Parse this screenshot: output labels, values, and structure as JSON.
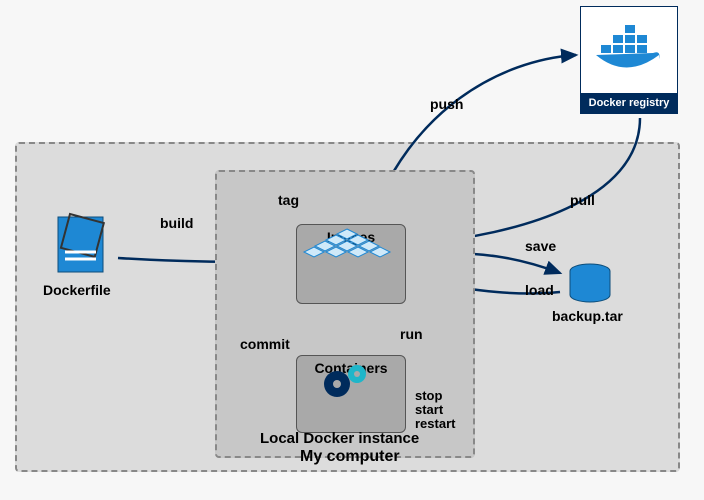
{
  "outer_label": "My computer",
  "inner_label": "Local Docker instance",
  "dockerfile": "Dockerfile",
  "backup": "backup.tar",
  "registry": {
    "title": "Docker registry"
  },
  "nodes": {
    "images": "Images",
    "containers": "Containers"
  },
  "cmds": {
    "build": "build",
    "tag": "tag",
    "push": "push",
    "pull": "pull",
    "save": "save",
    "load": "load",
    "run": "run",
    "commit": "commit",
    "stop": "stop",
    "start": "start",
    "restart": "restart"
  },
  "chart_data": {
    "type": "flow-diagram",
    "nodes": [
      {
        "id": "dockerfile",
        "label": "Dockerfile"
      },
      {
        "id": "images",
        "label": "Images",
        "group": "Local Docker instance"
      },
      {
        "id": "containers",
        "label": "Containers",
        "group": "Local Docker instance"
      },
      {
        "id": "registry",
        "label": "Docker registry"
      },
      {
        "id": "backup",
        "label": "backup.tar"
      }
    ],
    "edges": [
      {
        "from": "dockerfile",
        "to": "images",
        "label": "build"
      },
      {
        "from": "images",
        "to": "images",
        "label": "tag",
        "self": true
      },
      {
        "from": "images",
        "to": "registry",
        "label": "push"
      },
      {
        "from": "registry",
        "to": "images",
        "label": "pull"
      },
      {
        "from": "images",
        "to": "backup",
        "label": "save"
      },
      {
        "from": "backup",
        "to": "images",
        "label": "load"
      },
      {
        "from": "images",
        "to": "containers",
        "label": "run"
      },
      {
        "from": "containers",
        "to": "images",
        "label": "commit"
      },
      {
        "from": "containers",
        "to": "containers",
        "label": "stop",
        "self": true
      },
      {
        "from": "containers",
        "to": "containers",
        "label": "start",
        "self": true
      },
      {
        "from": "containers",
        "to": "containers",
        "label": "restart",
        "self": true
      }
    ],
    "groups": [
      {
        "id": "my_computer",
        "label": "My computer",
        "contains": [
          "dockerfile",
          "Local Docker instance",
          "backup"
        ]
      },
      {
        "id": "local_docker",
        "label": "Local Docker instance",
        "contains": [
          "images",
          "containers"
        ]
      }
    ]
  }
}
